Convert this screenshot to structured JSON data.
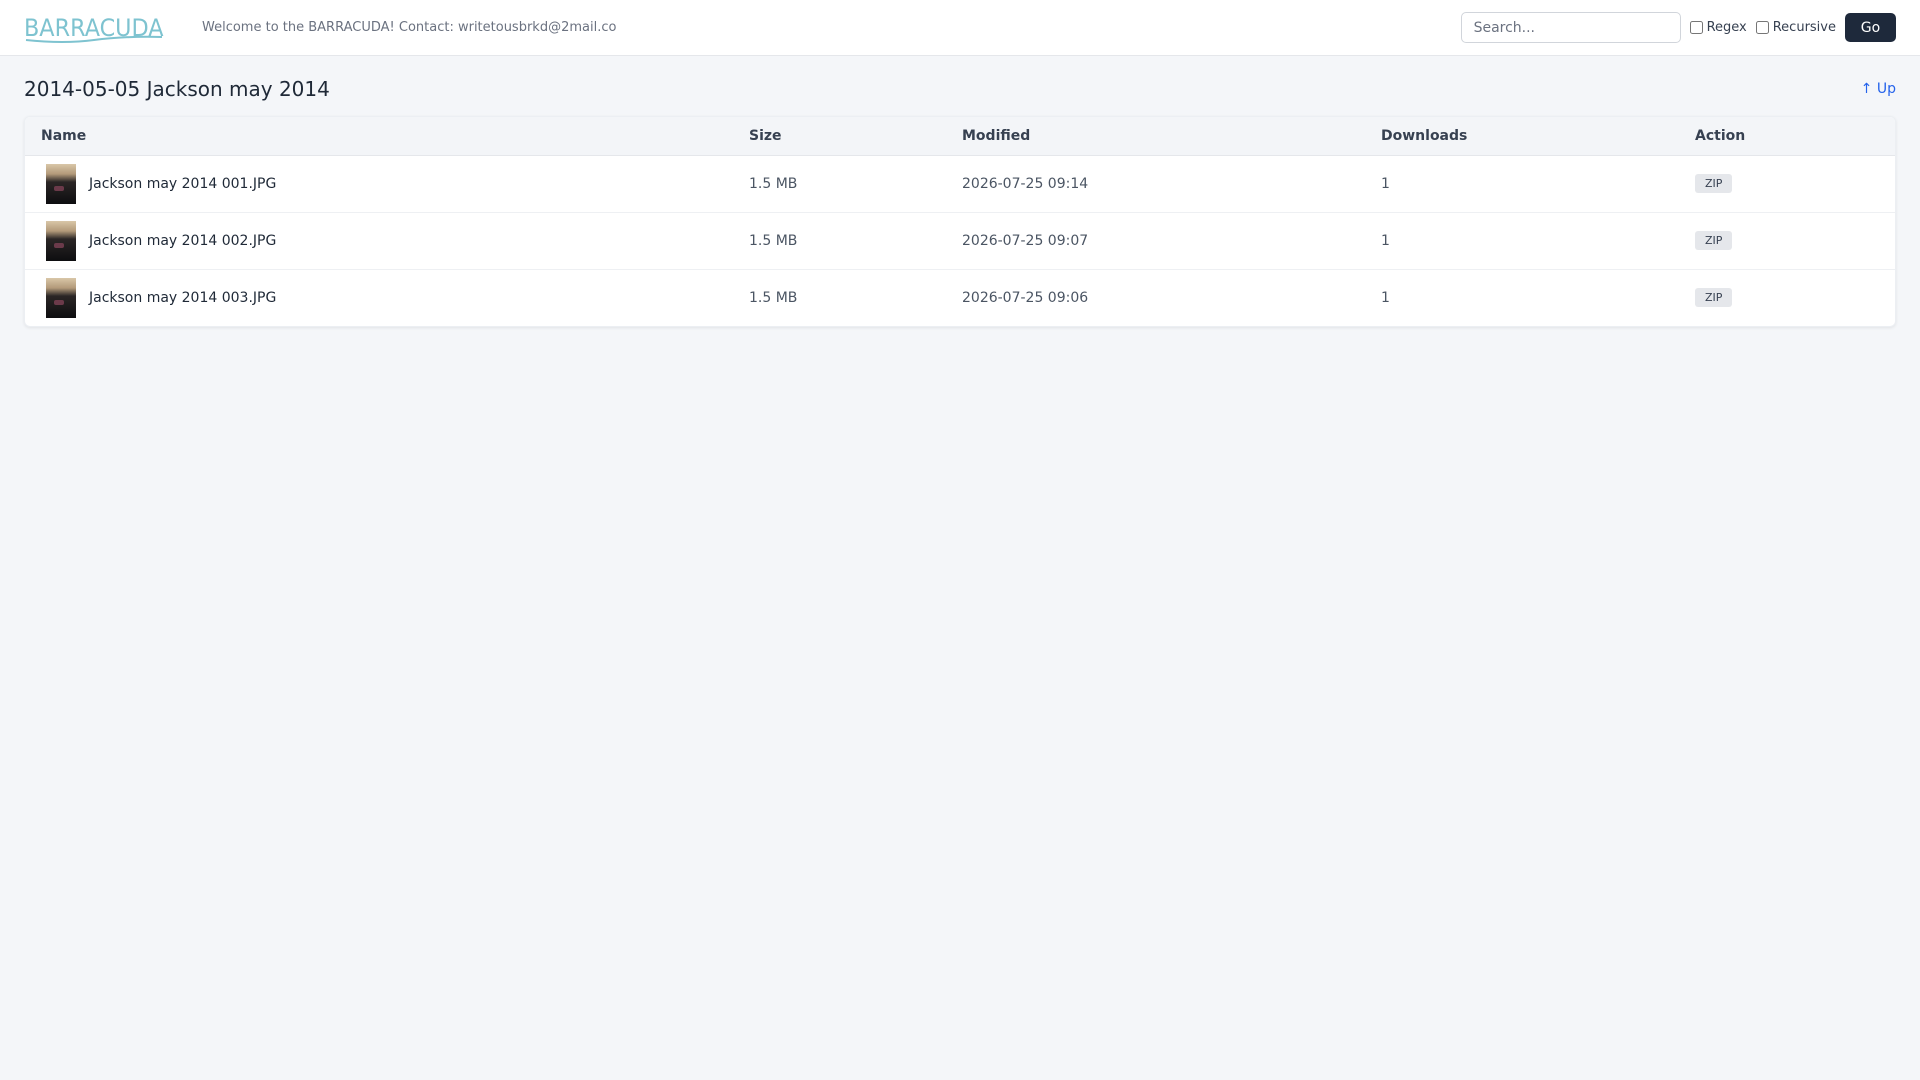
{
  "header": {
    "logo_text": "BARRACUDA",
    "welcome": "Welcome to the BARRACUDA! Contact: writetousbrkd@2mail.co",
    "search_placeholder": "Search...",
    "regex_label": "Regex",
    "recursive_label": "Recursive",
    "go_label": "Go",
    "brand_color": "#7ec3d0"
  },
  "page": {
    "title": "2014-05-05 Jackson may 2014",
    "up_label": "↑ Up"
  },
  "table": {
    "columns": [
      "Name",
      "Size",
      "Modified",
      "Downloads",
      "Action"
    ],
    "rows": [
      {
        "name": "Jackson may 2014 001.JPG",
        "size": "1.5 MB",
        "modified": "2026-07-25 09:14",
        "downloads": "1",
        "action": "ZIP"
      },
      {
        "name": "Jackson may 2014 002.JPG",
        "size": "1.5 MB",
        "modified": "2026-07-25 09:07",
        "downloads": "1",
        "action": "ZIP"
      },
      {
        "name": "Jackson may 2014 003.JPG",
        "size": "1.5 MB",
        "modified": "2026-07-25 09:06",
        "downloads": "1",
        "action": "ZIP"
      }
    ]
  }
}
